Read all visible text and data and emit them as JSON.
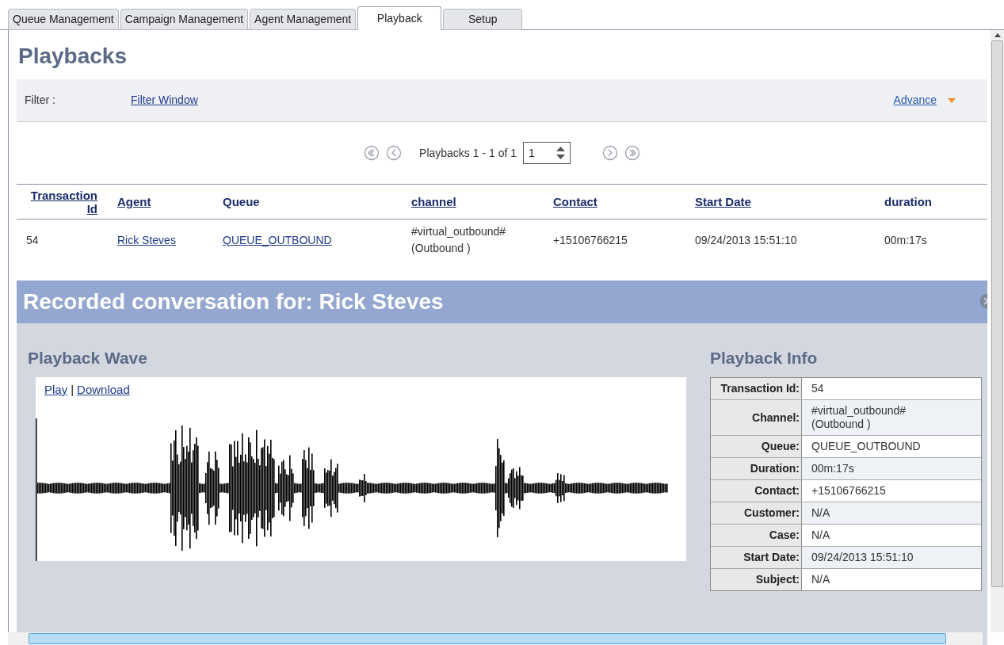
{
  "tabs": [
    {
      "label": "Queue Management",
      "selected": false
    },
    {
      "label": "Campaign Management",
      "selected": false
    },
    {
      "label": "Agent Management",
      "selected": false
    },
    {
      "label": "Playback",
      "selected": true
    },
    {
      "label": "Setup",
      "selected": false
    }
  ],
  "page_title": "Playbacks",
  "filter": {
    "label": "Filter :",
    "link": "Filter Window",
    "advance": "Advance"
  },
  "pagination": {
    "summary": "Playbacks 1 - 1 of 1",
    "page": "1"
  },
  "table": {
    "columns": [
      {
        "label": "Transaction Id",
        "sortable": true
      },
      {
        "label": "Agent",
        "sortable": true
      },
      {
        "label": "Queue",
        "sortable": false
      },
      {
        "label": "channel",
        "sortable": true
      },
      {
        "label": "Contact",
        "sortable": true
      },
      {
        "label": "Start Date",
        "sortable": true
      },
      {
        "label": "duration",
        "sortable": false
      }
    ],
    "rows": [
      [
        {
          "text": "54",
          "link": false
        },
        {
          "text": "Rick Steves",
          "link": true
        },
        {
          "text": "QUEUE_OUTBOUND",
          "link": true
        },
        {
          "text": "#virtual_outbound#\n(Outbound )",
          "link": false
        },
        {
          "text": "+15106766215",
          "link": false
        },
        {
          "text": "09/24/2013 15:51:10",
          "link": false
        },
        {
          "text": "00m:17s",
          "link": false
        }
      ]
    ]
  },
  "recording": {
    "title": "Recorded conversation for: Rick Steves",
    "wave_title": "Playback Wave",
    "play": "Play",
    "separator": "|",
    "download": "Download",
    "info_title": "Playback Info",
    "info": [
      {
        "label": "Transaction Id:",
        "value": "54"
      },
      {
        "label": "Channel:",
        "value": "#virtual_outbound#\n(Outbound )"
      },
      {
        "label": "Queue:",
        "value": "QUEUE_OUTBOUND"
      },
      {
        "label": "Duration:",
        "value": "00m:17s"
      },
      {
        "label": "Contact:",
        "value": "+15106766215"
      },
      {
        "label": "Customer:",
        "value": "N/A"
      },
      {
        "label": "Case:",
        "value": "N/A"
      },
      {
        "label": "Start Date:",
        "value": "09/24/2013 15:51:10"
      },
      {
        "label": "Subject:",
        "value": "N/A"
      }
    ]
  }
}
